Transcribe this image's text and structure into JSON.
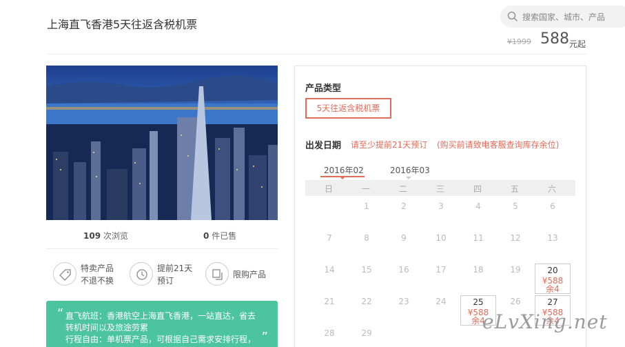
{
  "product": {
    "title": "上海直飞香港5天往返含税机票"
  },
  "search": {
    "placeholder": "搜索国家、城市、产品"
  },
  "price": {
    "original": "¥1999",
    "current": "588",
    "unit": "元起"
  },
  "stats": {
    "views_count": "109",
    "views_label": "次浏览",
    "sold_count": "0",
    "sold_label": "件已售"
  },
  "features": [
    {
      "icon": "tag-icon",
      "line1": "特卖产品",
      "line2": "不退不换"
    },
    {
      "icon": "clock-icon",
      "line1": "提前21天",
      "line2": "预订"
    },
    {
      "icon": "copy-icon",
      "line1": "限购产品",
      "line2": ""
    }
  ],
  "description": {
    "line1": "直飞航班：香港航空上海直飞香港，一站直达，省去",
    "line2": "转机时间以及旅途劳累",
    "line3": "行程自由：单机票产品，可根据自己需求安排行程，"
  },
  "booking": {
    "type_label": "产品类型",
    "type_option": "5天往返含税机票",
    "date_label": "出发日期",
    "notice1": "请至少提前21天预订",
    "notice2": "(购买前请致电客服查询库存余位)"
  },
  "calendar": {
    "months": [
      "2016年02",
      "2016年03"
    ],
    "weekdays": [
      "日",
      "一",
      "二",
      "三",
      "四",
      "五",
      "六"
    ],
    "weeks": [
      [
        "",
        "1",
        "2",
        "3",
        "4",
        "5",
        "6"
      ],
      [
        "7",
        "8",
        "9",
        "10",
        "11",
        "12",
        "13"
      ],
      [
        "14",
        "15",
        "16",
        "17",
        "18",
        "19",
        "20"
      ],
      [
        "21",
        "22",
        "23",
        "24",
        "25",
        "26",
        "27"
      ],
      [
        "28",
        "29",
        "",
        "",
        "",
        "",
        ""
      ]
    ],
    "available": [
      {
        "day": "20",
        "price": "¥588",
        "remain": "余4"
      },
      {
        "day": "25",
        "price": "¥588",
        "remain": "余4"
      },
      {
        "day": "27",
        "price": "¥588",
        "remain": "余4"
      }
    ]
  },
  "watermark": "eLvXing.net",
  "colors": {
    "accent": "#e06c5a",
    "green_box": "#4cc4a0"
  }
}
